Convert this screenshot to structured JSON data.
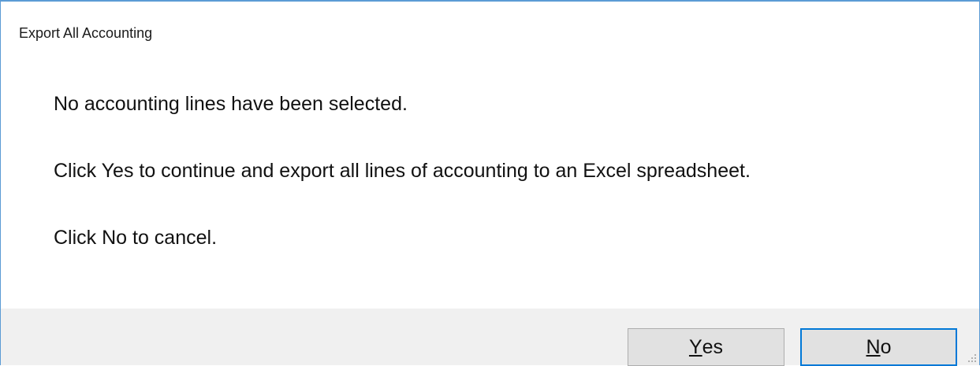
{
  "window": {
    "title": "Export All Accounting"
  },
  "message": {
    "line1": "No accounting lines have been selected.",
    "line2": "Click Yes to continue and export all lines of accounting to an Excel spreadsheet.",
    "line3": "Click No to cancel."
  },
  "buttons": {
    "yes": {
      "accel": "Y",
      "rest": "es"
    },
    "no": {
      "accel": "N",
      "rest": "o"
    }
  },
  "colors": {
    "border": "#5b9bd5",
    "footer_bg": "#f0f0f0",
    "focus_border": "#0078d7"
  },
  "icons": {
    "resize_grip": "resize-grip-icon"
  }
}
